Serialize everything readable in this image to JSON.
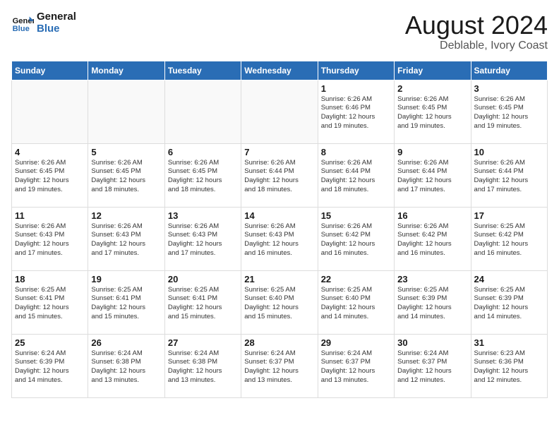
{
  "header": {
    "logo_line1": "General",
    "logo_line2": "Blue",
    "title": "August 2024",
    "subtitle": "Deblable, Ivory Coast"
  },
  "weekdays": [
    "Sunday",
    "Monday",
    "Tuesday",
    "Wednesday",
    "Thursday",
    "Friday",
    "Saturday"
  ],
  "weeks": [
    [
      {
        "day": "",
        "info": ""
      },
      {
        "day": "",
        "info": ""
      },
      {
        "day": "",
        "info": ""
      },
      {
        "day": "",
        "info": ""
      },
      {
        "day": "1",
        "info": "Sunrise: 6:26 AM\nSunset: 6:46 PM\nDaylight: 12 hours\nand 19 minutes."
      },
      {
        "day": "2",
        "info": "Sunrise: 6:26 AM\nSunset: 6:45 PM\nDaylight: 12 hours\nand 19 minutes."
      },
      {
        "day": "3",
        "info": "Sunrise: 6:26 AM\nSunset: 6:45 PM\nDaylight: 12 hours\nand 19 minutes."
      }
    ],
    [
      {
        "day": "4",
        "info": "Sunrise: 6:26 AM\nSunset: 6:45 PM\nDaylight: 12 hours\nand 19 minutes."
      },
      {
        "day": "5",
        "info": "Sunrise: 6:26 AM\nSunset: 6:45 PM\nDaylight: 12 hours\nand 18 minutes."
      },
      {
        "day": "6",
        "info": "Sunrise: 6:26 AM\nSunset: 6:45 PM\nDaylight: 12 hours\nand 18 minutes."
      },
      {
        "day": "7",
        "info": "Sunrise: 6:26 AM\nSunset: 6:44 PM\nDaylight: 12 hours\nand 18 minutes."
      },
      {
        "day": "8",
        "info": "Sunrise: 6:26 AM\nSunset: 6:44 PM\nDaylight: 12 hours\nand 18 minutes."
      },
      {
        "day": "9",
        "info": "Sunrise: 6:26 AM\nSunset: 6:44 PM\nDaylight: 12 hours\nand 17 minutes."
      },
      {
        "day": "10",
        "info": "Sunrise: 6:26 AM\nSunset: 6:44 PM\nDaylight: 12 hours\nand 17 minutes."
      }
    ],
    [
      {
        "day": "11",
        "info": "Sunrise: 6:26 AM\nSunset: 6:43 PM\nDaylight: 12 hours\nand 17 minutes."
      },
      {
        "day": "12",
        "info": "Sunrise: 6:26 AM\nSunset: 6:43 PM\nDaylight: 12 hours\nand 17 minutes."
      },
      {
        "day": "13",
        "info": "Sunrise: 6:26 AM\nSunset: 6:43 PM\nDaylight: 12 hours\nand 17 minutes."
      },
      {
        "day": "14",
        "info": "Sunrise: 6:26 AM\nSunset: 6:43 PM\nDaylight: 12 hours\nand 16 minutes."
      },
      {
        "day": "15",
        "info": "Sunrise: 6:26 AM\nSunset: 6:42 PM\nDaylight: 12 hours\nand 16 minutes."
      },
      {
        "day": "16",
        "info": "Sunrise: 6:26 AM\nSunset: 6:42 PM\nDaylight: 12 hours\nand 16 minutes."
      },
      {
        "day": "17",
        "info": "Sunrise: 6:25 AM\nSunset: 6:42 PM\nDaylight: 12 hours\nand 16 minutes."
      }
    ],
    [
      {
        "day": "18",
        "info": "Sunrise: 6:25 AM\nSunset: 6:41 PM\nDaylight: 12 hours\nand 15 minutes."
      },
      {
        "day": "19",
        "info": "Sunrise: 6:25 AM\nSunset: 6:41 PM\nDaylight: 12 hours\nand 15 minutes."
      },
      {
        "day": "20",
        "info": "Sunrise: 6:25 AM\nSunset: 6:41 PM\nDaylight: 12 hours\nand 15 minutes."
      },
      {
        "day": "21",
        "info": "Sunrise: 6:25 AM\nSunset: 6:40 PM\nDaylight: 12 hours\nand 15 minutes."
      },
      {
        "day": "22",
        "info": "Sunrise: 6:25 AM\nSunset: 6:40 PM\nDaylight: 12 hours\nand 14 minutes."
      },
      {
        "day": "23",
        "info": "Sunrise: 6:25 AM\nSunset: 6:39 PM\nDaylight: 12 hours\nand 14 minutes."
      },
      {
        "day": "24",
        "info": "Sunrise: 6:25 AM\nSunset: 6:39 PM\nDaylight: 12 hours\nand 14 minutes."
      }
    ],
    [
      {
        "day": "25",
        "info": "Sunrise: 6:24 AM\nSunset: 6:39 PM\nDaylight: 12 hours\nand 14 minutes."
      },
      {
        "day": "26",
        "info": "Sunrise: 6:24 AM\nSunset: 6:38 PM\nDaylight: 12 hours\nand 13 minutes."
      },
      {
        "day": "27",
        "info": "Sunrise: 6:24 AM\nSunset: 6:38 PM\nDaylight: 12 hours\nand 13 minutes."
      },
      {
        "day": "28",
        "info": "Sunrise: 6:24 AM\nSunset: 6:37 PM\nDaylight: 12 hours\nand 13 minutes."
      },
      {
        "day": "29",
        "info": "Sunrise: 6:24 AM\nSunset: 6:37 PM\nDaylight: 12 hours\nand 13 minutes."
      },
      {
        "day": "30",
        "info": "Sunrise: 6:24 AM\nSunset: 6:37 PM\nDaylight: 12 hours\nand 12 minutes."
      },
      {
        "day": "31",
        "info": "Sunrise: 6:23 AM\nSunset: 6:36 PM\nDaylight: 12 hours\nand 12 minutes."
      }
    ]
  ]
}
